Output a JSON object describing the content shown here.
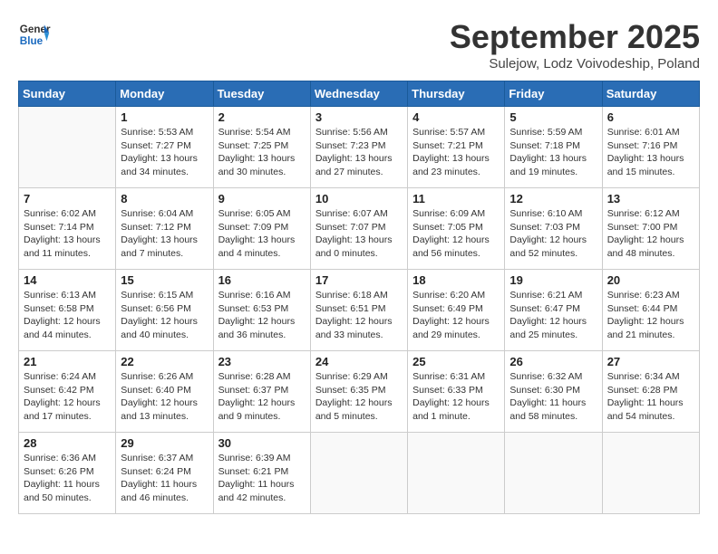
{
  "header": {
    "logo_general": "General",
    "logo_blue": "Blue",
    "month_title": "September 2025",
    "subtitle": "Sulejow, Lodz Voivodeship, Poland"
  },
  "weekdays": [
    "Sunday",
    "Monday",
    "Tuesday",
    "Wednesday",
    "Thursday",
    "Friday",
    "Saturday"
  ],
  "weeks": [
    [
      {
        "day": "",
        "info": ""
      },
      {
        "day": "1",
        "info": "Sunrise: 5:53 AM\nSunset: 7:27 PM\nDaylight: 13 hours\nand 34 minutes."
      },
      {
        "day": "2",
        "info": "Sunrise: 5:54 AM\nSunset: 7:25 PM\nDaylight: 13 hours\nand 30 minutes."
      },
      {
        "day": "3",
        "info": "Sunrise: 5:56 AM\nSunset: 7:23 PM\nDaylight: 13 hours\nand 27 minutes."
      },
      {
        "day": "4",
        "info": "Sunrise: 5:57 AM\nSunset: 7:21 PM\nDaylight: 13 hours\nand 23 minutes."
      },
      {
        "day": "5",
        "info": "Sunrise: 5:59 AM\nSunset: 7:18 PM\nDaylight: 13 hours\nand 19 minutes."
      },
      {
        "day": "6",
        "info": "Sunrise: 6:01 AM\nSunset: 7:16 PM\nDaylight: 13 hours\nand 15 minutes."
      }
    ],
    [
      {
        "day": "7",
        "info": "Sunrise: 6:02 AM\nSunset: 7:14 PM\nDaylight: 13 hours\nand 11 minutes."
      },
      {
        "day": "8",
        "info": "Sunrise: 6:04 AM\nSunset: 7:12 PM\nDaylight: 13 hours\nand 7 minutes."
      },
      {
        "day": "9",
        "info": "Sunrise: 6:05 AM\nSunset: 7:09 PM\nDaylight: 13 hours\nand 4 minutes."
      },
      {
        "day": "10",
        "info": "Sunrise: 6:07 AM\nSunset: 7:07 PM\nDaylight: 13 hours\nand 0 minutes."
      },
      {
        "day": "11",
        "info": "Sunrise: 6:09 AM\nSunset: 7:05 PM\nDaylight: 12 hours\nand 56 minutes."
      },
      {
        "day": "12",
        "info": "Sunrise: 6:10 AM\nSunset: 7:03 PM\nDaylight: 12 hours\nand 52 minutes."
      },
      {
        "day": "13",
        "info": "Sunrise: 6:12 AM\nSunset: 7:00 PM\nDaylight: 12 hours\nand 48 minutes."
      }
    ],
    [
      {
        "day": "14",
        "info": "Sunrise: 6:13 AM\nSunset: 6:58 PM\nDaylight: 12 hours\nand 44 minutes."
      },
      {
        "day": "15",
        "info": "Sunrise: 6:15 AM\nSunset: 6:56 PM\nDaylight: 12 hours\nand 40 minutes."
      },
      {
        "day": "16",
        "info": "Sunrise: 6:16 AM\nSunset: 6:53 PM\nDaylight: 12 hours\nand 36 minutes."
      },
      {
        "day": "17",
        "info": "Sunrise: 6:18 AM\nSunset: 6:51 PM\nDaylight: 12 hours\nand 33 minutes."
      },
      {
        "day": "18",
        "info": "Sunrise: 6:20 AM\nSunset: 6:49 PM\nDaylight: 12 hours\nand 29 minutes."
      },
      {
        "day": "19",
        "info": "Sunrise: 6:21 AM\nSunset: 6:47 PM\nDaylight: 12 hours\nand 25 minutes."
      },
      {
        "day": "20",
        "info": "Sunrise: 6:23 AM\nSunset: 6:44 PM\nDaylight: 12 hours\nand 21 minutes."
      }
    ],
    [
      {
        "day": "21",
        "info": "Sunrise: 6:24 AM\nSunset: 6:42 PM\nDaylight: 12 hours\nand 17 minutes."
      },
      {
        "day": "22",
        "info": "Sunrise: 6:26 AM\nSunset: 6:40 PM\nDaylight: 12 hours\nand 13 minutes."
      },
      {
        "day": "23",
        "info": "Sunrise: 6:28 AM\nSunset: 6:37 PM\nDaylight: 12 hours\nand 9 minutes."
      },
      {
        "day": "24",
        "info": "Sunrise: 6:29 AM\nSunset: 6:35 PM\nDaylight: 12 hours\nand 5 minutes."
      },
      {
        "day": "25",
        "info": "Sunrise: 6:31 AM\nSunset: 6:33 PM\nDaylight: 12 hours\nand 1 minute."
      },
      {
        "day": "26",
        "info": "Sunrise: 6:32 AM\nSunset: 6:30 PM\nDaylight: 11 hours\nand 58 minutes."
      },
      {
        "day": "27",
        "info": "Sunrise: 6:34 AM\nSunset: 6:28 PM\nDaylight: 11 hours\nand 54 minutes."
      }
    ],
    [
      {
        "day": "28",
        "info": "Sunrise: 6:36 AM\nSunset: 6:26 PM\nDaylight: 11 hours\nand 50 minutes."
      },
      {
        "day": "29",
        "info": "Sunrise: 6:37 AM\nSunset: 6:24 PM\nDaylight: 11 hours\nand 46 minutes."
      },
      {
        "day": "30",
        "info": "Sunrise: 6:39 AM\nSunset: 6:21 PM\nDaylight: 11 hours\nand 42 minutes."
      },
      {
        "day": "",
        "info": ""
      },
      {
        "day": "",
        "info": ""
      },
      {
        "day": "",
        "info": ""
      },
      {
        "day": "",
        "info": ""
      }
    ]
  ]
}
